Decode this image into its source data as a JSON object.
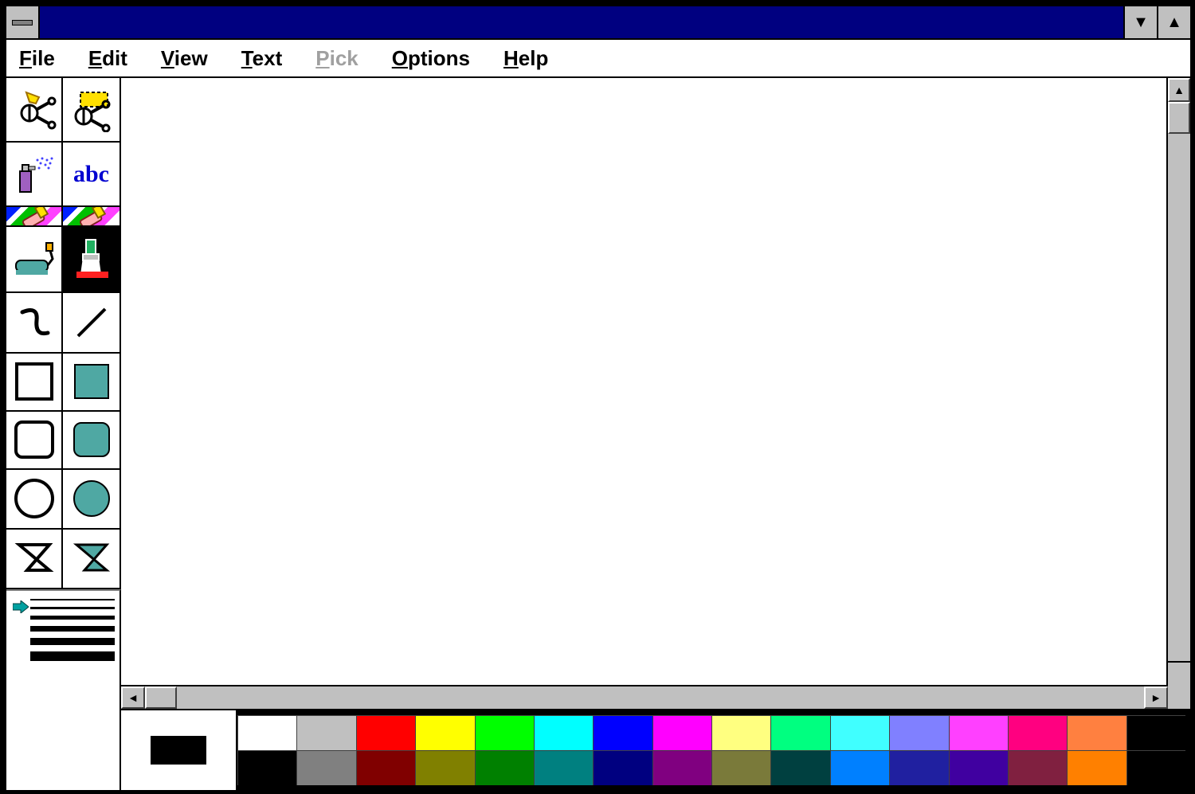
{
  "window": {
    "title": ""
  },
  "menu": {
    "file": {
      "mnemonic": "F",
      "rest": "ile"
    },
    "edit": {
      "mnemonic": "E",
      "rest": "dit"
    },
    "view": {
      "mnemonic": "V",
      "rest": "iew"
    },
    "text": {
      "mnemonic": "T",
      "rest": "ext"
    },
    "pick": {
      "mnemonic": "P",
      "rest": "ick",
      "disabled": true
    },
    "options": {
      "mnemonic": "O",
      "rest": "ptions"
    },
    "help": {
      "mnemonic": "H",
      "rest": "elp"
    }
  },
  "tools": {
    "text_tool_label": "abc",
    "active_tool": "brush"
  },
  "linewidths": [
    2,
    3,
    5,
    7,
    9,
    12
  ],
  "linewidth_selected_index": 0,
  "current_colors": {
    "foreground": "#000000",
    "background": "#ffffff"
  },
  "palette": [
    [
      "#ffffff",
      "#c0c0c0",
      "#ff0000",
      "#ffff00",
      "#00ff00",
      "#00ffff",
      "#0000ff",
      "#ff00ff",
      "#ffff80",
      "#00ff80",
      "#40ffff",
      "#8080ff",
      "#ff40ff",
      "#ff0080",
      "#ff8040",
      "#000000"
    ],
    [
      "#000000",
      "#808080",
      "#800000",
      "#808000",
      "#008000",
      "#008080",
      "#000080",
      "#800080",
      "#7a7a3a",
      "#004040",
      "#0080ff",
      "#2020a0",
      "#4000a0",
      "#802040",
      "#ff8000",
      "#000000"
    ]
  ]
}
